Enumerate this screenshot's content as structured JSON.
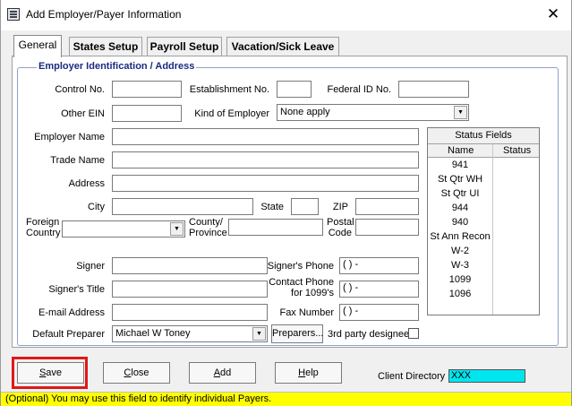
{
  "window": {
    "title": "Add Employer/Payer Information",
    "close_glyph": "✕"
  },
  "tabs": [
    {
      "label": "General",
      "active": true
    },
    {
      "label": "States Setup",
      "active": false
    },
    {
      "label": "Payroll Setup",
      "active": false
    },
    {
      "label": "Vacation/Sick Leave",
      "active": false
    }
  ],
  "group": {
    "title": "Employer Identification / Address"
  },
  "fields": {
    "control_no": {
      "label": "Control No.",
      "value": ""
    },
    "establishment_no": {
      "label": "Establishment No.",
      "value": ""
    },
    "federal_id": {
      "label": "Federal ID No.",
      "value": ""
    },
    "other_ein": {
      "label": "Other EIN",
      "value": ""
    },
    "kind_of_employer": {
      "label": "Kind of Employer",
      "value": "None apply"
    },
    "employer_name": {
      "label": "Employer Name",
      "value": ""
    },
    "trade_name": {
      "label": "Trade Name",
      "value": ""
    },
    "address": {
      "label": "Address",
      "value": ""
    },
    "city": {
      "label": "City",
      "value": ""
    },
    "state": {
      "label": "State",
      "value": ""
    },
    "zip": {
      "label": "ZIP",
      "value": ""
    },
    "foreign_country": {
      "label_line1": "Foreign",
      "label_line2": "Country",
      "value": ""
    },
    "county_province": {
      "label_line1": "County/",
      "label_line2": "Province",
      "value": ""
    },
    "postal_code": {
      "label_line1": "Postal",
      "label_line2": "Code",
      "value": ""
    },
    "signer": {
      "label": "Signer",
      "value": ""
    },
    "signers_phone": {
      "label": "Signer's Phone",
      "value": "(   )    -"
    },
    "signers_title": {
      "label": "Signer's Title",
      "value": ""
    },
    "contact_phone": {
      "label_line1": "Contact Phone",
      "label_line2": "for 1099's",
      "value": "(   )    -"
    },
    "email": {
      "label": "E-mail Address",
      "value": ""
    },
    "fax": {
      "label": "Fax Number",
      "value": "(   )    -"
    },
    "default_preparer": {
      "label": "Default Preparer",
      "value": "Michael W Toney"
    },
    "third_party": {
      "label": "3rd party designee",
      "checked": false
    }
  },
  "preparers_button": "Preparers...",
  "status_fields": {
    "title": "Status Fields",
    "col_name": "Name",
    "col_status": "Status",
    "rows": [
      "941",
      "St Qtr WH",
      "St Qtr UI",
      "944",
      "940",
      "St Ann Recon",
      "W-2",
      "W-3",
      "1099",
      "1096"
    ]
  },
  "buttons": {
    "save": {
      "first": "S",
      "rest": "ave"
    },
    "close": {
      "first": "C",
      "rest": "lose"
    },
    "add": {
      "first": "A",
      "rest": "dd"
    },
    "help": {
      "first": "H",
      "rest": "elp"
    }
  },
  "client_directory": {
    "label": "Client Directory",
    "value": "XXX"
  },
  "statusbar": {
    "text": "(Optional) You may use this field to identify individual Payers."
  },
  "colors": {
    "highlight": "#e01818",
    "client_dir_bg": "#00e5ee",
    "statusbar_bg": "#ffff00",
    "group_title": "#1a2a80"
  }
}
